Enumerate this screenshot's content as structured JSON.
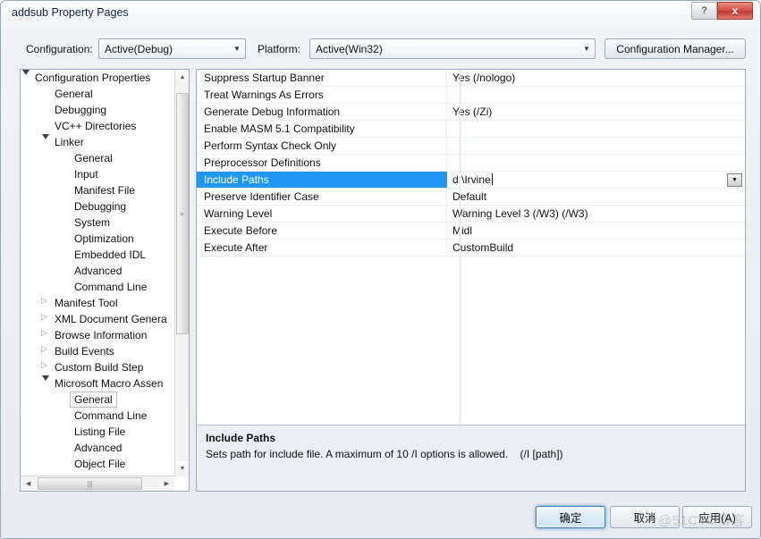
{
  "window": {
    "title": "addsub Property Pages",
    "help_button": "?",
    "close_button": "x",
    "help_icon_name": "help-icon",
    "close_icon_name": "close-icon"
  },
  "header": {
    "configuration_label": "Configuration:",
    "configuration_value": "Active(Debug)",
    "platform_label": "Platform:",
    "platform_value": "Active(Win32)",
    "configuration_manager_button": "Configuration Manager..."
  },
  "tree": {
    "items": [
      {
        "label": "Configuration Properties",
        "indent": 0,
        "state": "expanded",
        "selected": false
      },
      {
        "label": "General",
        "indent": 1,
        "state": "leaf",
        "selected": false
      },
      {
        "label": "Debugging",
        "indent": 1,
        "state": "leaf",
        "selected": false
      },
      {
        "label": "VC++ Directories",
        "indent": 1,
        "state": "leaf",
        "selected": false
      },
      {
        "label": "Linker",
        "indent": 1,
        "state": "expanded",
        "selected": false
      },
      {
        "label": "General",
        "indent": 2,
        "state": "leaf",
        "selected": false
      },
      {
        "label": "Input",
        "indent": 2,
        "state": "leaf",
        "selected": false
      },
      {
        "label": "Manifest File",
        "indent": 2,
        "state": "leaf",
        "selected": false
      },
      {
        "label": "Debugging",
        "indent": 2,
        "state": "leaf",
        "selected": false
      },
      {
        "label": "System",
        "indent": 2,
        "state": "leaf",
        "selected": false
      },
      {
        "label": "Optimization",
        "indent": 2,
        "state": "leaf",
        "selected": false
      },
      {
        "label": "Embedded IDL",
        "indent": 2,
        "state": "leaf",
        "selected": false
      },
      {
        "label": "Advanced",
        "indent": 2,
        "state": "leaf",
        "selected": false
      },
      {
        "label": "Command Line",
        "indent": 2,
        "state": "leaf",
        "selected": false
      },
      {
        "label": "Manifest Tool",
        "indent": 1,
        "state": "collapsed",
        "selected": false
      },
      {
        "label": "XML Document Genera",
        "indent": 1,
        "state": "collapsed",
        "selected": false
      },
      {
        "label": "Browse Information",
        "indent": 1,
        "state": "collapsed",
        "selected": false
      },
      {
        "label": "Build Events",
        "indent": 1,
        "state": "collapsed",
        "selected": false
      },
      {
        "label": "Custom Build Step",
        "indent": 1,
        "state": "collapsed",
        "selected": false
      },
      {
        "label": "Microsoft Macro Assen",
        "indent": 1,
        "state": "expanded",
        "selected": false
      },
      {
        "label": "General",
        "indent": 2,
        "state": "leaf",
        "selected": true
      },
      {
        "label": "Command Line",
        "indent": 2,
        "state": "leaf",
        "selected": false
      },
      {
        "label": "Listing File",
        "indent": 2,
        "state": "leaf",
        "selected": false
      },
      {
        "label": "Advanced",
        "indent": 2,
        "state": "leaf",
        "selected": false
      },
      {
        "label": "Object File",
        "indent": 2,
        "state": "leaf",
        "selected": false
      },
      {
        "label": "Code Analysis",
        "indent": 1,
        "state": "collapsed",
        "selected": false
      }
    ]
  },
  "grid": {
    "rows": [
      {
        "name": "Suppress Startup Banner",
        "value": "Yes (/nologo)",
        "selected": false,
        "editing": false
      },
      {
        "name": "Treat Warnings As Errors",
        "value": "",
        "selected": false,
        "editing": false
      },
      {
        "name": "Generate Debug Information",
        "value": "Yes (/Zi)",
        "selected": false,
        "editing": false
      },
      {
        "name": "Enable MASM 5.1 Compatibility",
        "value": "",
        "selected": false,
        "editing": false
      },
      {
        "name": "Perform Syntax Check Only",
        "value": "",
        "selected": false,
        "editing": false
      },
      {
        "name": "Preprocessor Definitions",
        "value": "",
        "selected": false,
        "editing": false
      },
      {
        "name": "Include Paths",
        "value": "d:\\Irvine",
        "selected": true,
        "editing": true
      },
      {
        "name": "Preserve Identifier Case",
        "value": "Default",
        "selected": false,
        "editing": false
      },
      {
        "name": "Warning Level",
        "value": "Warning Level 3 (/W3) (/W3)",
        "selected": false,
        "editing": false
      },
      {
        "name": "Execute Before",
        "value": "Midl",
        "selected": false,
        "editing": false
      },
      {
        "name": "Execute After",
        "value": "CustomBuild",
        "selected": false,
        "editing": false
      }
    ]
  },
  "description": {
    "title": "Include Paths",
    "body": "Sets path for include file. A maximum of 10 /I options is allowed.    (/I [path])"
  },
  "footer": {
    "ok_button": "确定",
    "cancel_button": "取消",
    "apply_button": "应用(A)"
  },
  "watermark": {
    "text": "@51CTO博客"
  },
  "colors": {
    "selection_blue": "#2196f3",
    "close_red": "#c0392b",
    "focus_border": "#3c7fb1",
    "description_bg": "#eceef3"
  }
}
